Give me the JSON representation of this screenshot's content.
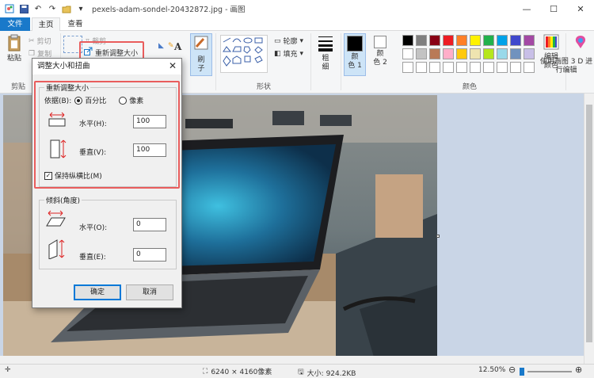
{
  "window": {
    "title": "pexels-adam-sondel-20432872.jpg - 画图",
    "minimize": "—",
    "maximize": "☐",
    "close": "✕"
  },
  "tabs": {
    "file": "文件",
    "home": "主页",
    "view": "查看"
  },
  "ribbon": {
    "clipboard": {
      "paste": "粘贴",
      "cut": "剪切",
      "copy": "复制",
      "label": "剪贴"
    },
    "image": {
      "crop": "裁剪",
      "resize": "重新调整大小"
    },
    "tools": {},
    "brush": {
      "label": "刷\n子"
    },
    "shapes": {
      "outline": "轮廓",
      "fill": "填充",
      "label": "形状"
    },
    "size": {
      "label": "粗\n细"
    },
    "colors": {
      "color1": "颜\n色 1",
      "color2": "颜\n色 2",
      "edit": "编辑\n颜色",
      "paint3d": "使用画图 3\nD 进行编辑",
      "label": "颜色",
      "swatches": [
        "#000000",
        "#7f7f7f",
        "#880015",
        "#ed1c24",
        "#ff7f27",
        "#fff200",
        "#22b14c",
        "#00a2e8",
        "#3f48cc",
        "#a349a4",
        "#ffffff",
        "#c3c3c3",
        "#b97a57",
        "#ffaec9",
        "#ffc90e",
        "#efe4b0",
        "#b5e61d",
        "#99d9ea",
        "#7092be",
        "#c8bfe7",
        "#ffffff",
        "#ffffff",
        "#ffffff",
        "#ffffff",
        "#ffffff",
        "#ffffff",
        "#ffffff",
        "#ffffff",
        "#ffffff",
        "#ffffff"
      ]
    }
  },
  "dialog": {
    "title": "调整大小和扭曲",
    "resize_legend": "重新调整大小",
    "by_label": "依据(B):",
    "percent": "百分比",
    "pixels": "像素",
    "horizontal_label": "水平(H):",
    "horizontal_value": "100",
    "vertical_label": "垂直(V):",
    "vertical_value": "100",
    "keep_ratio": "保持纵横比(M)",
    "skew_legend": "倾斜(角度)",
    "skew_h_label": "水平(O):",
    "skew_h_value": "0",
    "skew_v_label": "垂直(E):",
    "skew_v_value": "0",
    "ok": "确定",
    "cancel": "取消"
  },
  "status": {
    "dimensions": "6240 × 4160像素",
    "size": "大小: 924.2KB",
    "zoom": "12.50%"
  }
}
